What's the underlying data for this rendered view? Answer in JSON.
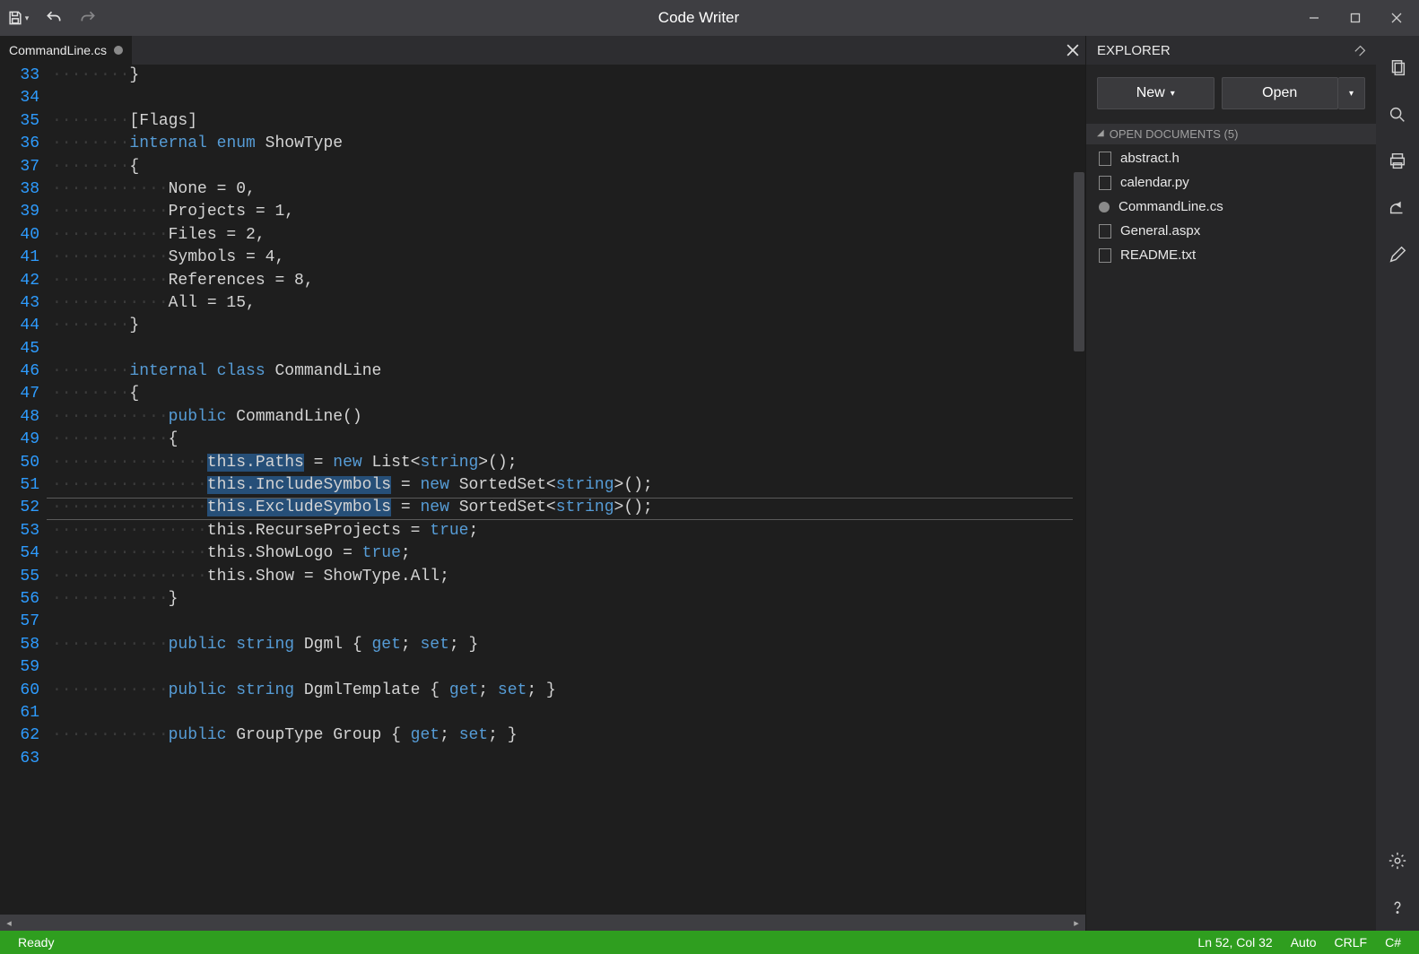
{
  "window": {
    "title": "Code Writer"
  },
  "tab": {
    "filename": "CommandLine.cs",
    "dirty": true
  },
  "explorer": {
    "title": "EXPLORER",
    "new_label": "New",
    "open_label": "Open",
    "section_label": "OPEN DOCUMENTS (5)",
    "documents": [
      {
        "name": "abstract.h",
        "dirty": false
      },
      {
        "name": "calendar.py",
        "dirty": false
      },
      {
        "name": "CommandLine.cs",
        "dirty": true
      },
      {
        "name": "General.aspx",
        "dirty": false
      },
      {
        "name": "README.txt",
        "dirty": false
      }
    ]
  },
  "status": {
    "ready": "Ready",
    "position": "Ln 52, Col 32",
    "encoding": "Auto",
    "eol": "CRLF",
    "language": "C#"
  },
  "editor": {
    "first_line_number": 33,
    "current_line_index": 19,
    "highlight_ranges_by_index": {
      "17": [
        [
          0,
          10
        ]
      ],
      "18": [
        [
          0,
          19
        ]
      ],
      "19": [
        [
          0,
          19
        ]
      ]
    },
    "lines": [
      {
        "indent": 2,
        "tokens": [
          [
            "}",
            ""
          ]
        ]
      },
      {
        "indent": 0,
        "tokens": []
      },
      {
        "indent": 2,
        "tokens": [
          [
            "[Flags]",
            ""
          ]
        ]
      },
      {
        "indent": 2,
        "tokens": [
          [
            "internal",
            "kw"
          ],
          [
            " ",
            ""
          ],
          [
            "enum",
            "kw"
          ],
          [
            " ShowType",
            ""
          ]
        ]
      },
      {
        "indent": 2,
        "tokens": [
          [
            "{",
            ""
          ]
        ]
      },
      {
        "indent": 3,
        "tokens": [
          [
            "None = 0,",
            ""
          ]
        ]
      },
      {
        "indent": 3,
        "tokens": [
          [
            "Projects = 1,",
            ""
          ]
        ]
      },
      {
        "indent": 3,
        "tokens": [
          [
            "Files = 2,",
            ""
          ]
        ]
      },
      {
        "indent": 3,
        "tokens": [
          [
            "Symbols = 4,",
            ""
          ]
        ]
      },
      {
        "indent": 3,
        "tokens": [
          [
            "References = 8,",
            ""
          ]
        ]
      },
      {
        "indent": 3,
        "tokens": [
          [
            "All = 15,",
            ""
          ]
        ]
      },
      {
        "indent": 2,
        "tokens": [
          [
            "}",
            ""
          ]
        ]
      },
      {
        "indent": 0,
        "tokens": []
      },
      {
        "indent": 2,
        "tokens": [
          [
            "internal",
            "kw"
          ],
          [
            " ",
            ""
          ],
          [
            "class",
            "kw"
          ],
          [
            " CommandLine",
            ""
          ]
        ]
      },
      {
        "indent": 2,
        "tokens": [
          [
            "{",
            ""
          ]
        ]
      },
      {
        "indent": 3,
        "tokens": [
          [
            "public",
            "kw"
          ],
          [
            " CommandLine()",
            ""
          ]
        ]
      },
      {
        "indent": 3,
        "tokens": [
          [
            "{",
            ""
          ]
        ]
      },
      {
        "indent": 4,
        "tokens": [
          [
            "this",
            ""
          ],
          [
            ".Paths = ",
            ""
          ],
          [
            "new",
            "kw"
          ],
          [
            " List<",
            ""
          ],
          [
            "string",
            "str"
          ],
          [
            ">();",
            ""
          ]
        ]
      },
      {
        "indent": 4,
        "tokens": [
          [
            "this",
            ""
          ],
          [
            ".IncludeSymbols",
            ""
          ],
          [
            " = ",
            ""
          ],
          [
            "new",
            "kw"
          ],
          [
            " SortedSet<",
            ""
          ],
          [
            "string",
            "str"
          ],
          [
            ">();",
            ""
          ]
        ]
      },
      {
        "indent": 4,
        "tokens": [
          [
            "this",
            ""
          ],
          [
            ".ExcludeSymbols",
            ""
          ],
          [
            " = ",
            ""
          ],
          [
            "new",
            "kw"
          ],
          [
            " SortedSet<",
            ""
          ],
          [
            "string",
            "str"
          ],
          [
            ">();",
            ""
          ]
        ]
      },
      {
        "indent": 4,
        "tokens": [
          [
            "this",
            ""
          ],
          [
            ".RecurseProjects = ",
            ""
          ],
          [
            "true",
            "kw"
          ],
          [
            ";",
            ""
          ]
        ]
      },
      {
        "indent": 4,
        "tokens": [
          [
            "this",
            ""
          ],
          [
            ".ShowLogo = ",
            ""
          ],
          [
            "true",
            "kw"
          ],
          [
            ";",
            ""
          ]
        ]
      },
      {
        "indent": 4,
        "tokens": [
          [
            "this",
            ""
          ],
          [
            ".Show = ShowType.All;",
            ""
          ]
        ]
      },
      {
        "indent": 3,
        "tokens": [
          [
            "}",
            ""
          ]
        ]
      },
      {
        "indent": 0,
        "tokens": []
      },
      {
        "indent": 3,
        "tokens": [
          [
            "public",
            "kw"
          ],
          [
            " ",
            ""
          ],
          [
            "string",
            "kw"
          ],
          [
            " Dgml { ",
            ""
          ],
          [
            "get",
            "kw"
          ],
          [
            "; ",
            ""
          ],
          [
            "set",
            "kw"
          ],
          [
            "; }",
            ""
          ]
        ]
      },
      {
        "indent": 0,
        "tokens": []
      },
      {
        "indent": 3,
        "tokens": [
          [
            "public",
            "kw"
          ],
          [
            " ",
            ""
          ],
          [
            "string",
            "kw"
          ],
          [
            " DgmlTemplate { ",
            ""
          ],
          [
            "get",
            "kw"
          ],
          [
            "; ",
            ""
          ],
          [
            "set",
            "kw"
          ],
          [
            "; }",
            ""
          ]
        ]
      },
      {
        "indent": 0,
        "tokens": []
      },
      {
        "indent": 3,
        "tokens": [
          [
            "public",
            "kw"
          ],
          [
            " GroupType Group { ",
            ""
          ],
          [
            "get",
            "kw"
          ],
          [
            "; ",
            ""
          ],
          [
            "set",
            "kw"
          ],
          [
            "; }",
            ""
          ]
        ]
      },
      {
        "indent": 0,
        "tokens": []
      }
    ]
  }
}
